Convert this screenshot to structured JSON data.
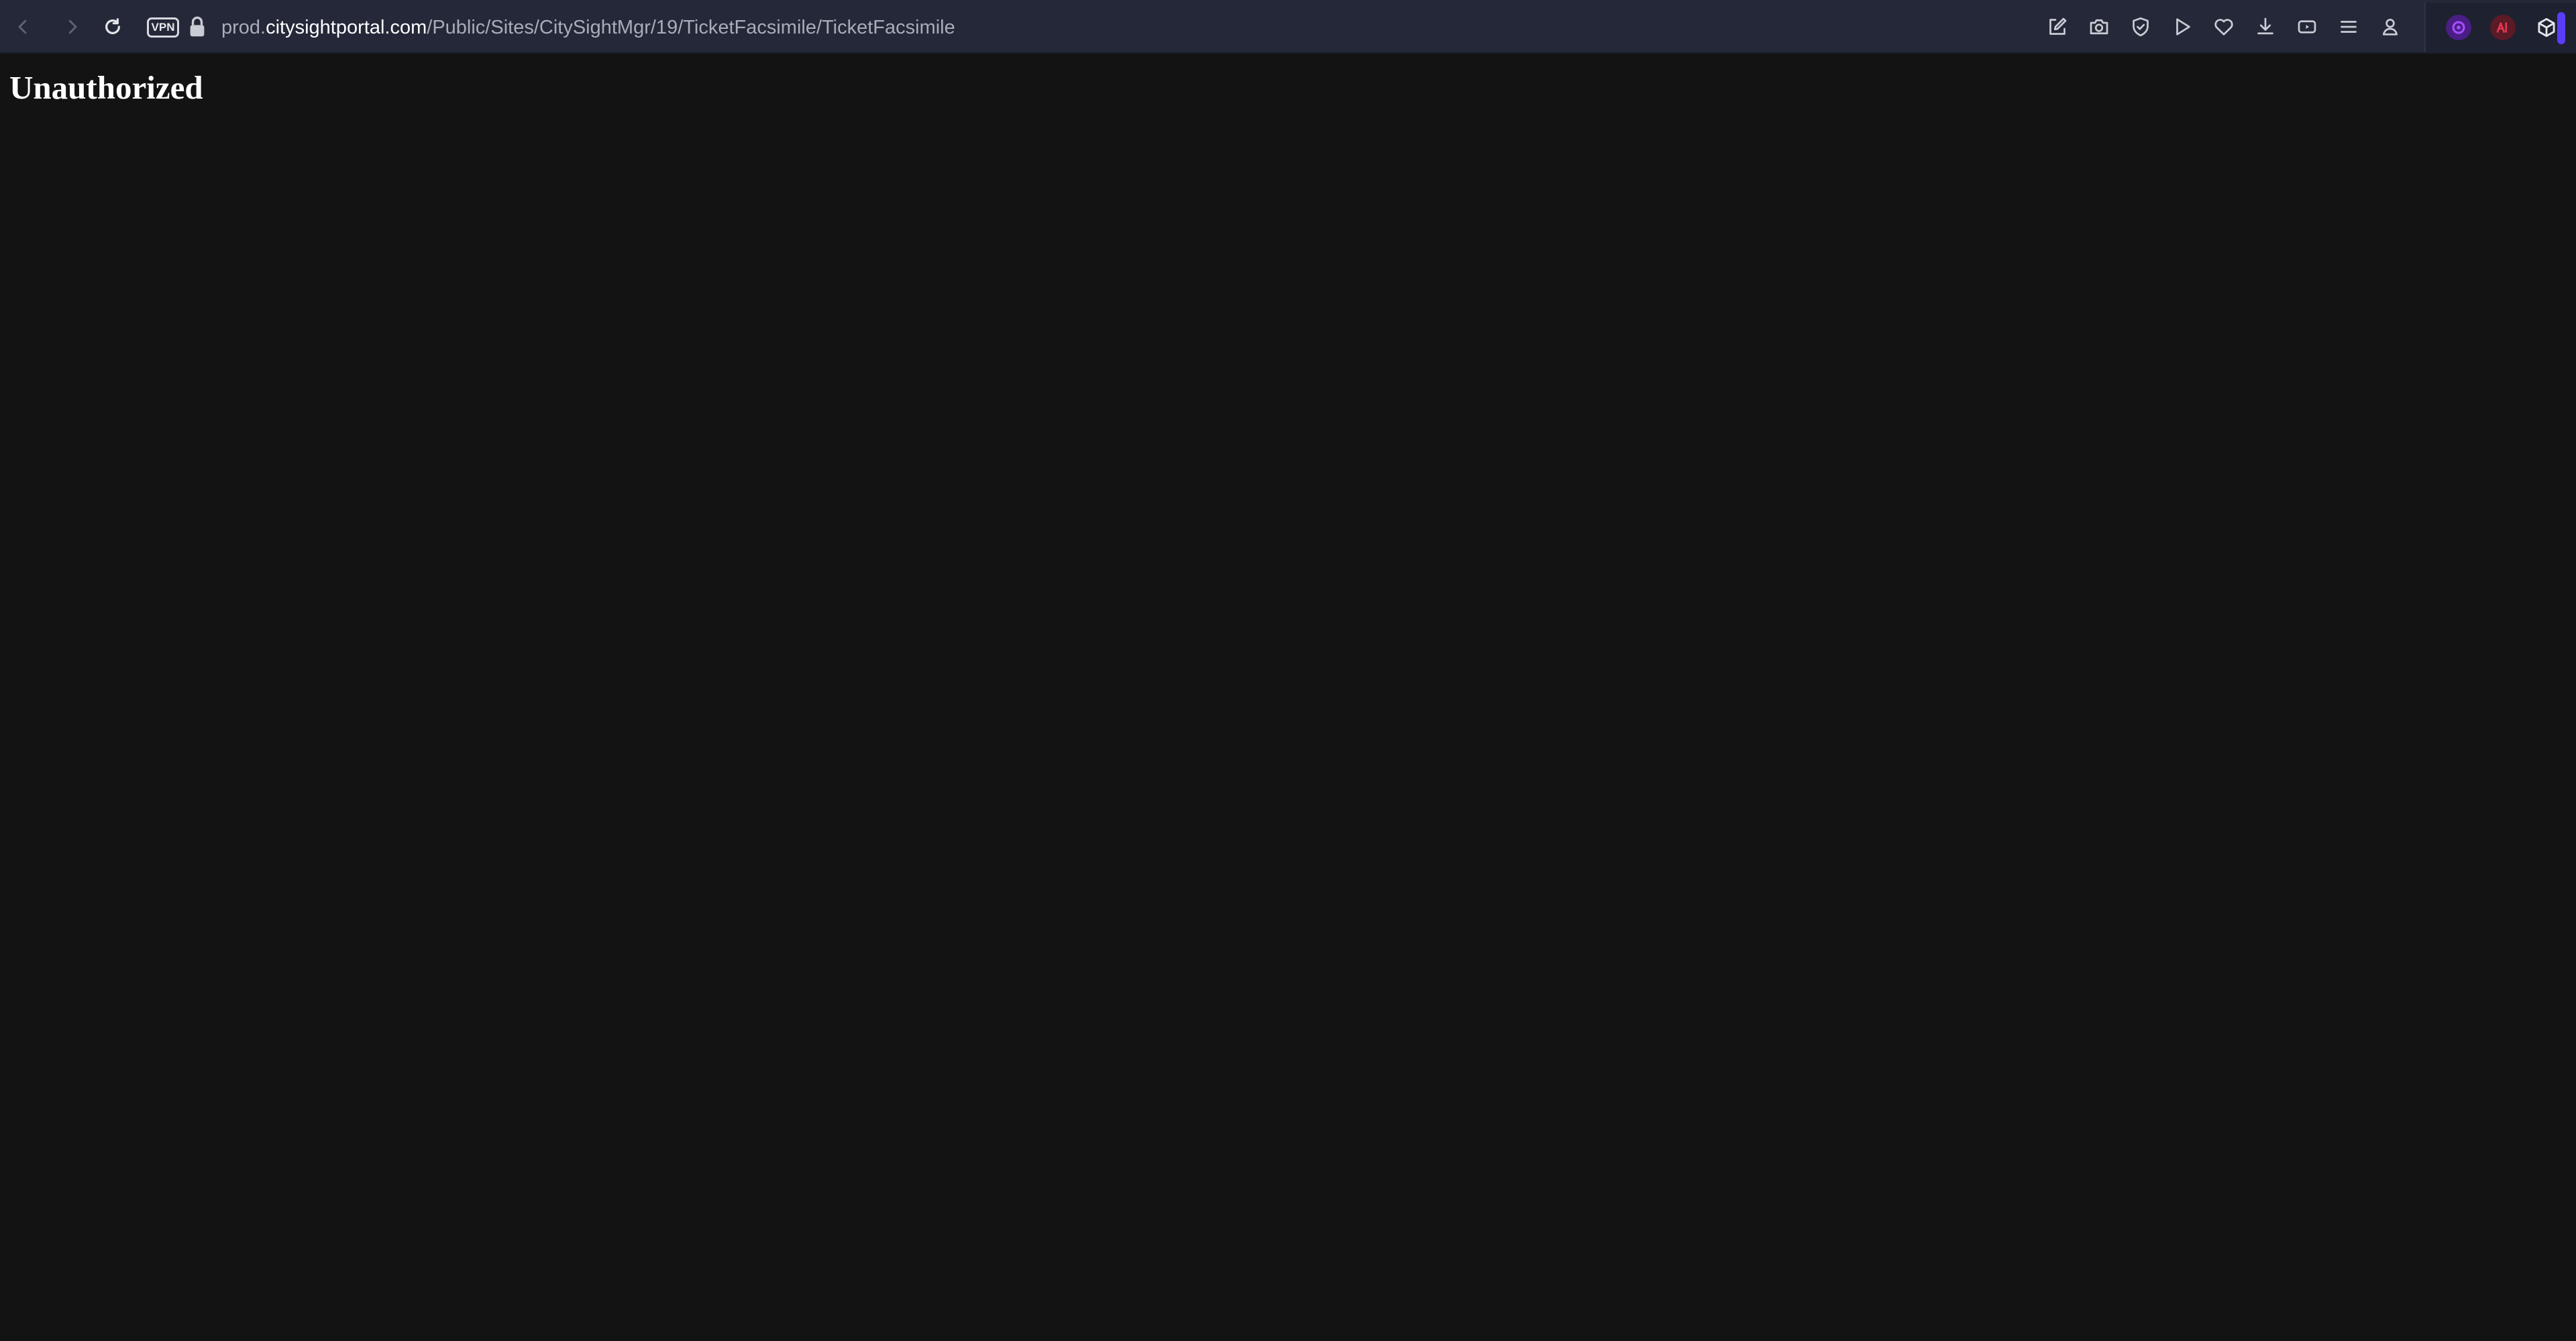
{
  "browser": {
    "vpn_label": "VPN",
    "address": {
      "prefix": "prod.",
      "domain": "citysightportal.com",
      "path": "/Public/Sites/CitySightMgr/19/TicketFacsimile/TicketFacsimile"
    },
    "toolbar_icons": [
      "back-icon",
      "forward-icon",
      "reload-icon",
      "lock-icon",
      "edit-icon",
      "camera-icon",
      "shield-icon",
      "play-icon",
      "heart-icon",
      "download-icon",
      "wallet-icon",
      "menu-icon",
      "profile-icon",
      "extension-icon",
      "ai-extension-icon",
      "cube-icon"
    ],
    "colors": {
      "toolbar_bg": "#242838",
      "page_bg": "#131314",
      "accent": "#5b3df5"
    }
  },
  "page": {
    "heading": "Unauthorized"
  }
}
